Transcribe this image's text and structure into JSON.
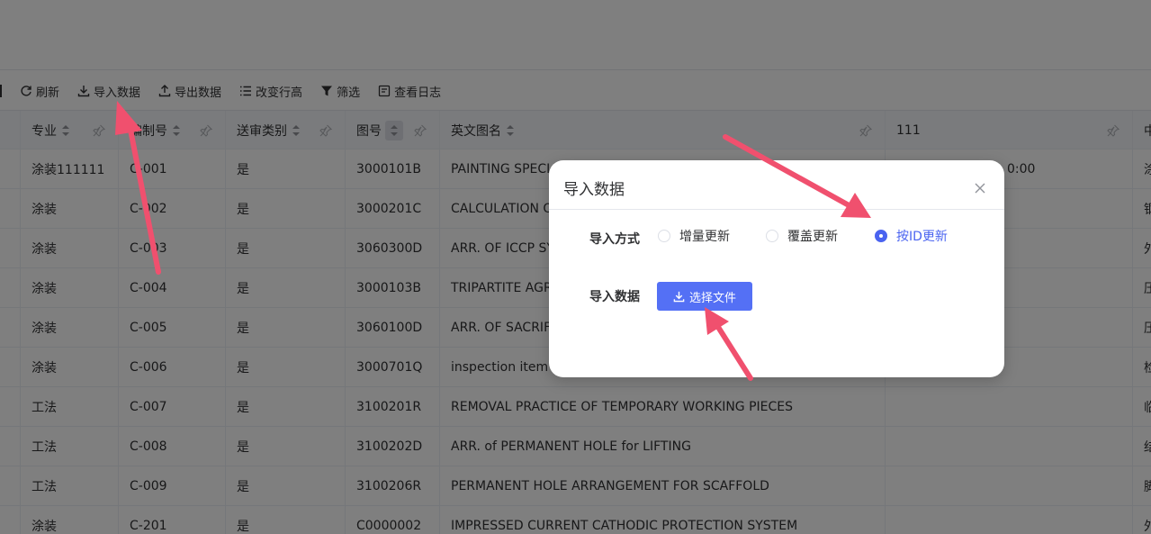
{
  "toolbar": {
    "items": [
      {
        "label": "刷新",
        "icon": "refresh-icon"
      },
      {
        "label": "导入数据",
        "icon": "download-icon"
      },
      {
        "label": "导出数据",
        "icon": "upload-icon"
      },
      {
        "label": "改变行高",
        "icon": "list-icon"
      },
      {
        "label": "筛选",
        "icon": "filter-icon"
      },
      {
        "label": "查看日志",
        "icon": "log-icon"
      }
    ]
  },
  "table": {
    "columns": [
      "专业",
      "编制号",
      "送审类别",
      "图号",
      "英文图名",
      "111",
      "中"
    ],
    "rows": [
      [
        "涂装111111",
        "C-001",
        "是",
        "3000101B",
        "PAINTING SPECI",
        "0:00",
        "涂"
      ],
      [
        "涂装",
        "C-002",
        "是",
        "3000201C",
        "CALCULATION O",
        "",
        "钢"
      ],
      [
        "涂装",
        "C-003",
        "是",
        "3060300D",
        "ARR. OF ICCP SY",
        "",
        "外"
      ],
      [
        "涂装",
        "C-004",
        "是",
        "3000103B",
        "TRIPARTITE AGR",
        "",
        "压"
      ],
      [
        "涂装",
        "C-005",
        "是",
        "3060100D",
        "ARR. OF SACRIF",
        "",
        "压"
      ],
      [
        "涂装",
        "C-006",
        "是",
        "3000701Q",
        "inspection item l",
        "",
        "检"
      ],
      [
        "工法",
        "C-007",
        "是",
        "3100201R",
        "REMOVAL PRACTICE OF TEMPORARY WORKING PIECES",
        "",
        "临"
      ],
      [
        "工法",
        "C-008",
        "是",
        "3100202D",
        "ARR. of PERMANENT HOLE for LIFTING",
        "",
        "结"
      ],
      [
        "工法",
        "C-009",
        "是",
        "3100206R",
        "PERMANENT HOLE ARRANGEMENT FOR SCAFFOLD",
        "",
        "脚"
      ],
      [
        "涂装",
        "C-201",
        "是",
        "C0000002",
        "IMPRESSED CURRENT CATHODIC PROTECTION SYSTEM",
        "",
        "外"
      ]
    ]
  },
  "dialog": {
    "title": "导入数据",
    "import_mode_label": "导入方式",
    "options": [
      "增量更新",
      "覆盖更新",
      "按ID更新"
    ],
    "selected": "按ID更新",
    "import_data_label": "导入数据",
    "upload_label": "选择文件"
  },
  "colors": {
    "accent": "#5470f5",
    "arrow": "#f0506e",
    "overlay": "rgba(0,0,0,0.5)"
  }
}
